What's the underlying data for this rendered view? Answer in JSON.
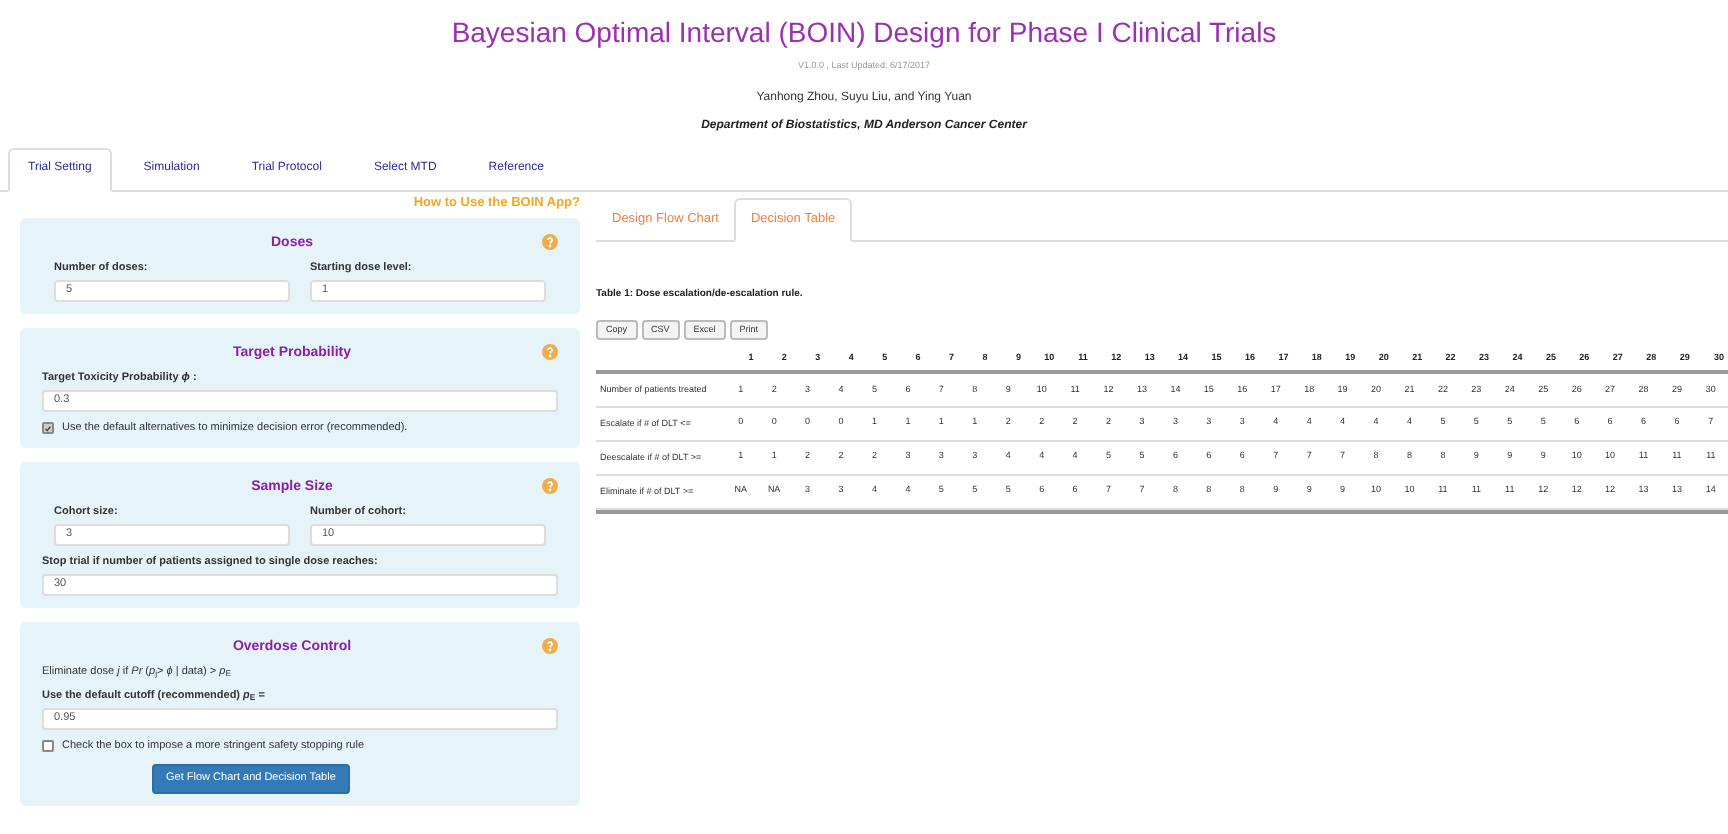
{
  "header": {
    "title": "Bayesian Optimal Interval (BOIN) Design for Phase I Clinical Trials",
    "version": "V1.0.0 , Last Updated: 6/17/2017",
    "authors": "Yanhong Zhou, Suyu Liu, and Ying Yuan",
    "department": "Department of Biostatistics, MD Anderson Cancer Center"
  },
  "tabs": [
    {
      "label": "Trial Setting",
      "selected": true
    },
    {
      "label": "Simulation",
      "selected": false
    },
    {
      "label": "Trial Protocol",
      "selected": false
    },
    {
      "label": "Select MTD",
      "selected": false
    },
    {
      "label": "Reference",
      "selected": false
    }
  ],
  "help_link": "How to Use the BOIN App?",
  "panels": [
    {
      "title": "Doses",
      "rows": [
        [
          {
            "label": "Number of doses:",
            "value": "5"
          },
          {
            "label": "Starting dose level:",
            "value": "1"
          }
        ]
      ]
    },
    {
      "title": "Target Probability",
      "rows": [
        [
          {
            "label": "Target Toxicity Probability *ϕ* :",
            "value": "0.3"
          }
        ]
      ],
      "checkbox": {
        "label": "Use the default alternatives to minimize decision error (recommended).",
        "checked": true
      }
    },
    {
      "title": "Sample Size",
      "rows": [
        [
          {
            "label": "Cohort size:",
            "value": "3"
          },
          {
            "label": "Number of cohort:",
            "value": "10"
          }
        ],
        [
          {
            "label": "Stop trial if number of patients assigned to single dose reaches:",
            "value": "30"
          }
        ]
      ]
    },
    {
      "title": "Overdose Control",
      "note": "Eliminate dose *j* if *Pr* (*p*$_{j}$> *ϕ* | data) > *p*$_{E}$",
      "rows": [
        [
          {
            "label": "Use the default cutoff (recommended) *p*$_{E}$ =",
            "value": "0.95"
          }
        ]
      ],
      "checkbox": {
        "label": "Check the box to impose a more stringent safety stopping rule",
        "checked": false
      },
      "button": "Get Flow Chart and Decision Table"
    }
  ],
  "result_tabs": [
    {
      "label": "Design Flow Chart",
      "selected": false
    },
    {
      "label": "Decision Table",
      "selected": true
    }
  ],
  "table_caption": "Table 1: Dose escalation/de-escalation rule.",
  "export_buttons": [
    "Copy",
    "CSV",
    "Excel",
    "Print"
  ],
  "table": {
    "columns": [
      "1",
      "2",
      "3",
      "4",
      "5",
      "6",
      "7",
      "8",
      "9",
      "10",
      "11",
      "12",
      "13",
      "14",
      "15",
      "16",
      "17",
      "18",
      "19",
      "20",
      "21",
      "22",
      "23",
      "24",
      "25",
      "26",
      "27",
      "28",
      "29",
      "30"
    ],
    "rows": [
      {
        "label": "Number of patients treated",
        "values": [
          "1",
          "2",
          "3",
          "4",
          "5",
          "6",
          "7",
          "8",
          "9",
          "10",
          "11",
          "12",
          "13",
          "14",
          "15",
          "16",
          "17",
          "18",
          "19",
          "20",
          "21",
          "22",
          "23",
          "24",
          "25",
          "26",
          "27",
          "28",
          "29",
          "30"
        ]
      },
      {
        "label": "Escalate if # of DLT <=",
        "values": [
          "0",
          "0",
          "0",
          "0",
          "1",
          "1",
          "1",
          "1",
          "2",
          "2",
          "2",
          "2",
          "3",
          "3",
          "3",
          "3",
          "4",
          "4",
          "4",
          "4",
          "4",
          "5",
          "5",
          "5",
          "5",
          "6",
          "6",
          "6",
          "6",
          "7"
        ]
      },
      {
        "label": "Deescalate if # of DLT >=",
        "values": [
          "1",
          "1",
          "2",
          "2",
          "2",
          "3",
          "3",
          "3",
          "4",
          "4",
          "4",
          "5",
          "5",
          "6",
          "6",
          "6",
          "7",
          "7",
          "7",
          "8",
          "8",
          "8",
          "9",
          "9",
          "9",
          "10",
          "10",
          "11",
          "11",
          "11"
        ]
      },
      {
        "label": "Eliminate if # of DLT >=",
        "values": [
          "NA",
          "NA",
          "3",
          "3",
          "4",
          "4",
          "5",
          "5",
          "5",
          "6",
          "6",
          "7",
          "7",
          "8",
          "8",
          "8",
          "9",
          "9",
          "9",
          "10",
          "10",
          "11",
          "11",
          "11",
          "12",
          "12",
          "12",
          "13",
          "13",
          "14"
        ]
      }
    ]
  }
}
